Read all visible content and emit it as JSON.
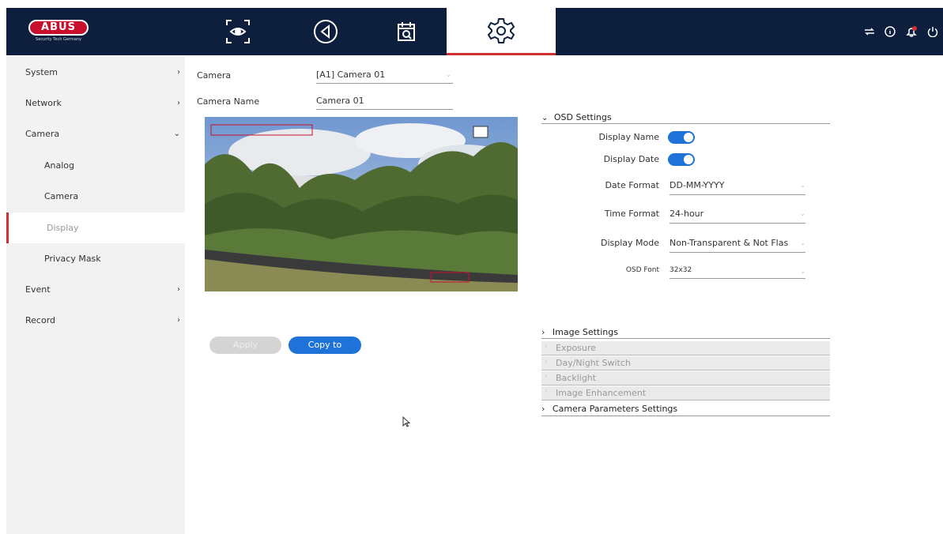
{
  "brand": {
    "name": "ABUS",
    "tagline": "Security Tech Germany",
    "accent": "#d0302f",
    "topbar_color": "#0d1f3c",
    "toggle_color": "#1f73d8"
  },
  "nav": [
    {
      "icon": "live-view-icon"
    },
    {
      "icon": "playback-icon"
    },
    {
      "icon": "search-calendar-icon"
    },
    {
      "icon": "settings-gear-icon",
      "active": true
    }
  ],
  "top_right_icons": [
    "network-icon",
    "info-icon",
    "alarm-bell-icon",
    "power-icon"
  ],
  "sidebar": {
    "items": [
      {
        "label": "System",
        "chevron": "›"
      },
      {
        "label": "Network",
        "chevron": "›"
      },
      {
        "label": "Camera",
        "chevron": "⌄"
      },
      {
        "label": "Analog"
      },
      {
        "label": "Camera"
      },
      {
        "label": "Display"
      },
      {
        "label": "Privacy Mask"
      },
      {
        "label": "Event",
        "chevron": "›"
      },
      {
        "label": "Record",
        "chevron": "›"
      }
    ]
  },
  "main": {
    "camera_label": "Camera",
    "camera_value": "[A1] Camera 01",
    "camera_name_label": "Camera Name",
    "camera_name_value": "Camera 01",
    "apply_label": "Apply",
    "copy_label": "Copy to"
  },
  "osd": {
    "title": "OSD Settings",
    "display_name_label": "Display Name",
    "display_name_on": true,
    "display_date_label": "Display Date",
    "display_date_on": true,
    "date_format_label": "Date Format",
    "date_format_value": "DD-MM-YYYY",
    "time_format_label": "Time Format",
    "time_format_value": "24-hour",
    "display_mode_label": "Display Mode",
    "display_mode_value": "Non-Transparent & Not Flas",
    "osd_font_label": "OSD Font",
    "osd_font_value": "32x32"
  },
  "image_settings": {
    "title": "Image Settings",
    "items": [
      "Exposure",
      "Day/Night Switch",
      "Backlight",
      "Image Enhancement"
    ]
  },
  "camera_params": {
    "title": "Camera Parameters Settings"
  }
}
